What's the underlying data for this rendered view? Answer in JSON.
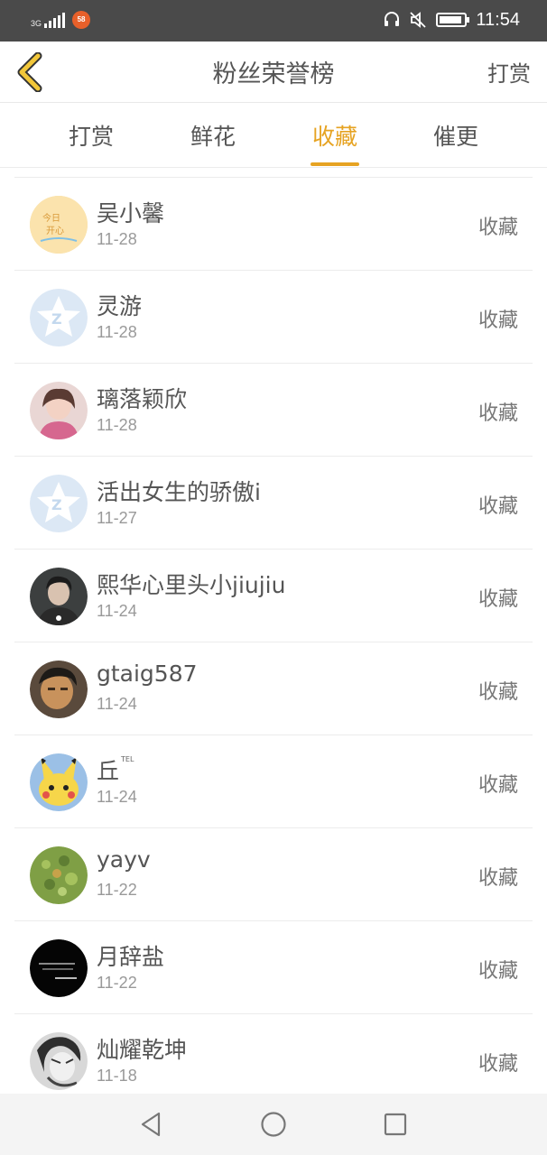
{
  "status_bar": {
    "network": "3G",
    "app_badge": "58",
    "time": "11:54",
    "icons": [
      "signal-icon",
      "headset-icon",
      "mute-icon",
      "battery-icon"
    ]
  },
  "header": {
    "title": "粉丝荣誉榜",
    "right_label": "打赏",
    "back_icon": "chevron-left-icon"
  },
  "tabs": [
    {
      "label": "打赏",
      "active": false
    },
    {
      "label": "鲜花",
      "active": false
    },
    {
      "label": "收藏",
      "active": true
    },
    {
      "label": "催更",
      "active": false
    }
  ],
  "colors": {
    "accent": "#e6a322",
    "status_bar": "#4a4a4a"
  },
  "fans": [
    {
      "name": "吴小馨",
      "date": "11-28",
      "action": "收藏",
      "avatar": "cartoon-avatar"
    },
    {
      "name": "灵游",
      "date": "11-28",
      "action": "收藏",
      "avatar": "default-avatar"
    },
    {
      "name": "璃落颖欣",
      "date": "11-28",
      "action": "收藏",
      "avatar": "photo-avatar"
    },
    {
      "name": "活出女生的骄傲i",
      "date": "11-27",
      "action": "收藏",
      "avatar": "default-avatar"
    },
    {
      "name": "熙华心里头小jiujiu",
      "date": "11-24",
      "action": "收藏",
      "avatar": "photo-avatar"
    },
    {
      "name": "gtaig587",
      "date": "11-24",
      "action": "收藏",
      "avatar": "photo-avatar"
    },
    {
      "name": "丘",
      "superscript": "TEL",
      "date": "11-24",
      "action": "收藏",
      "avatar": "pikachu-avatar"
    },
    {
      "name": "yayv",
      "date": "11-22",
      "action": "收藏",
      "avatar": "photo-avatar"
    },
    {
      "name": "月辞盐",
      "date": "11-22",
      "action": "收藏",
      "avatar": "dark-text-avatar"
    },
    {
      "name": "灿耀乾坤",
      "date": "11-18",
      "action": "收藏",
      "avatar": "anime-avatar"
    }
  ],
  "nav_bar": [
    "back-triangle-icon",
    "home-circle-icon",
    "recents-square-icon"
  ]
}
